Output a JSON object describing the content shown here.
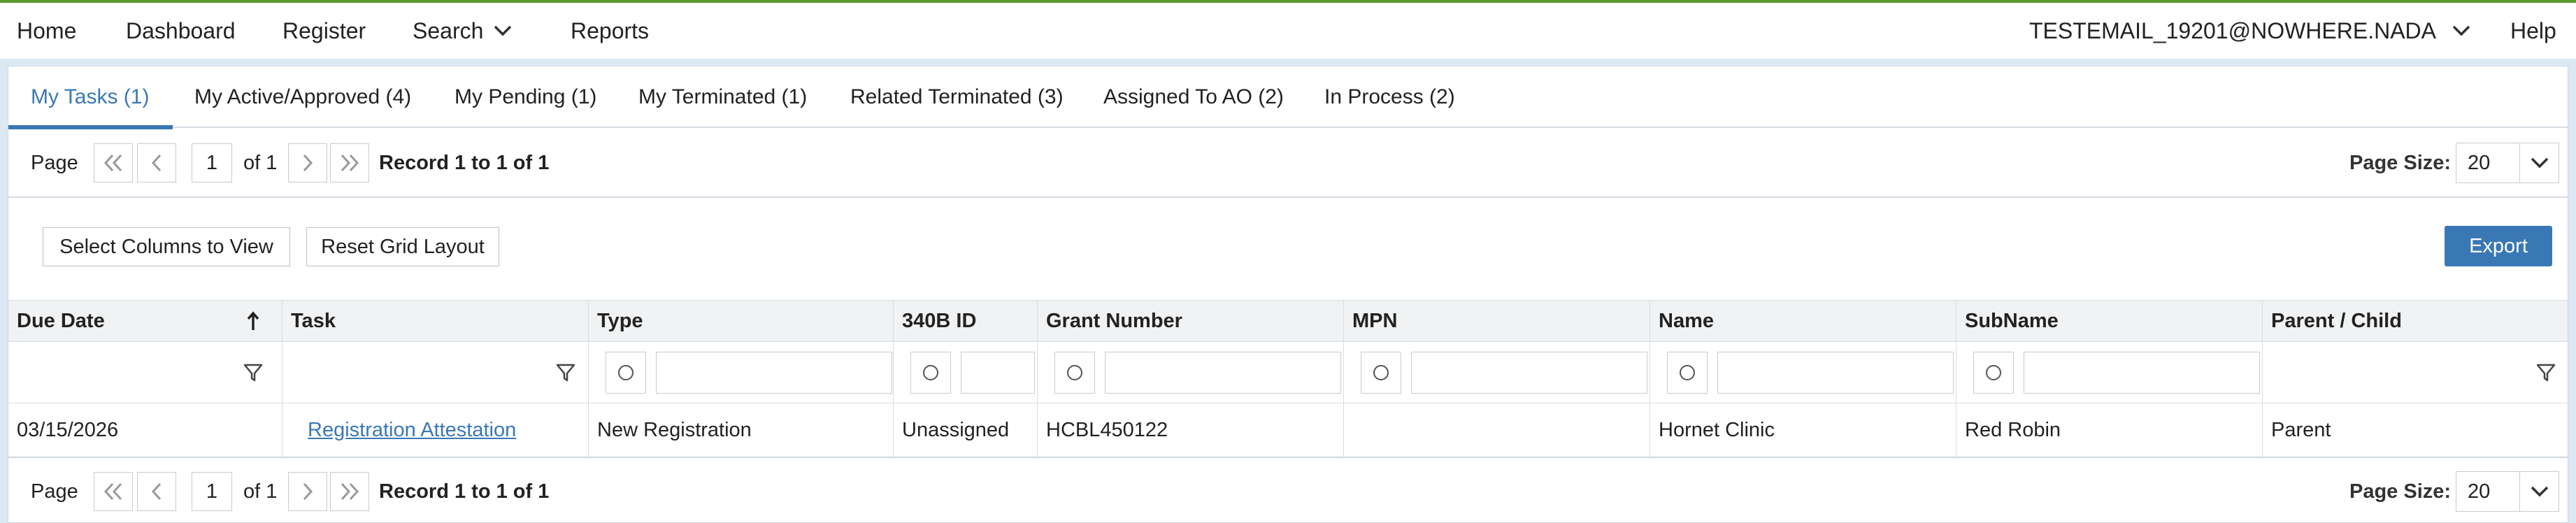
{
  "nav": {
    "home": "Home",
    "dashboard": "Dashboard",
    "register": "Register",
    "search": "Search",
    "reports": "Reports",
    "user": "TESTEMAIL_19201@NOWHERE.NADA",
    "help": "Help"
  },
  "tabs": [
    {
      "label": "My Tasks (1)",
      "active": true
    },
    {
      "label": "My Active/Approved (4)"
    },
    {
      "label": "My Pending (1)"
    },
    {
      "label": "My Terminated (1)"
    },
    {
      "label": "Related Terminated (3)"
    },
    {
      "label": "Assigned To AO (2)"
    },
    {
      "label": "In Process (2)"
    }
  ],
  "pager": {
    "page_label": "Page",
    "current_page": "1",
    "of_label": "of 1",
    "record_text": "Record 1 to 1 of 1",
    "page_size_label": "Page Size:",
    "page_size_value": "20"
  },
  "toolbar": {
    "select_columns": "Select Columns to View",
    "reset_layout": "Reset Grid Layout",
    "export": "Export"
  },
  "grid": {
    "columns": [
      "Due Date",
      "Task",
      "Type",
      "340B ID",
      "Grant Number",
      "MPN",
      "Name",
      "SubName",
      "Parent / Child"
    ],
    "sort": {
      "column": "Due Date",
      "direction": "ascending"
    },
    "rows": [
      {
        "due_date": "03/15/2026",
        "task": "Registration Attestation",
        "type": "New Registration",
        "id_340b": "Unassigned",
        "grant_number": "HCBL450122",
        "mpn": "",
        "name": "Hornet Clinic",
        "subname": "Red Robin",
        "parent_child": "Parent"
      }
    ]
  },
  "colors": {
    "accent": "#3a78b5",
    "top_line": "#5a9a2a",
    "page_bg": "#dce9f5"
  }
}
